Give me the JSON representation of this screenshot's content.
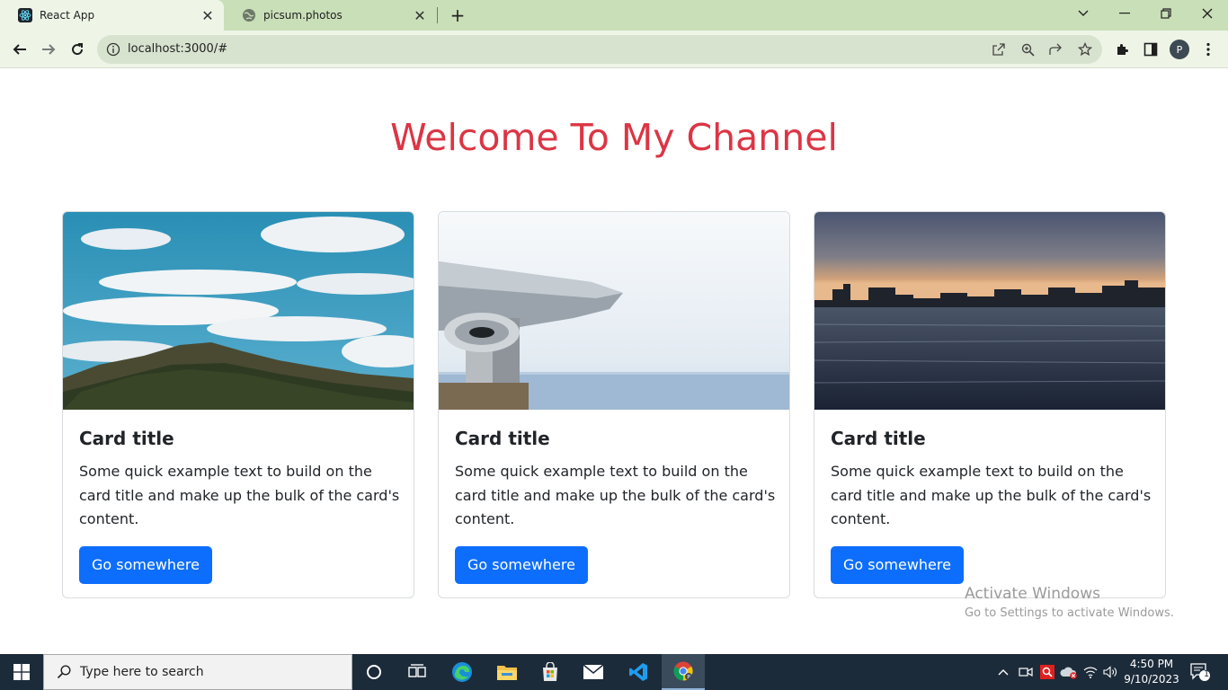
{
  "browser": {
    "tabs": [
      {
        "title": "React App",
        "favicon": "react-icon",
        "active": true
      },
      {
        "title": "picsum.photos",
        "favicon": "globe-icon",
        "active": false
      }
    ],
    "url": "localhost:3000/#",
    "profile_initial": "P"
  },
  "page": {
    "heading": "Welcome To My Channel",
    "heading_color": "#dc3545",
    "cards": [
      {
        "image": "mountain-clouds-photo",
        "title": "Card title",
        "text": "Some quick example text to build on the card title and make up the bulk of the card's content.",
        "button": "Go somewhere"
      },
      {
        "image": "binocular-viewer-photo",
        "title": "Card title",
        "text": "Some quick example text to build on the card title and make up the bulk of the card's content.",
        "button": "Go somewhere"
      },
      {
        "image": "city-skyline-water-photo",
        "title": "Card title",
        "text": "Some quick example text to build on the card title and make up the bulk of the card's content.",
        "button": "Go somewhere"
      }
    ],
    "button_color": "#0d6efd"
  },
  "watermark": {
    "line1": "Activate Windows",
    "line2": "Go to Settings to activate Windows."
  },
  "taskbar": {
    "search_placeholder": "Type here to search",
    "time": "4:50 PM",
    "date": "9/10/2023",
    "notification_count": "1",
    "apps": [
      "cortana-icon",
      "task-view-icon",
      "edge-icon",
      "file-explorer-icon",
      "store-icon",
      "mail-icon",
      "vscode-icon",
      "chrome-icon"
    ]
  }
}
